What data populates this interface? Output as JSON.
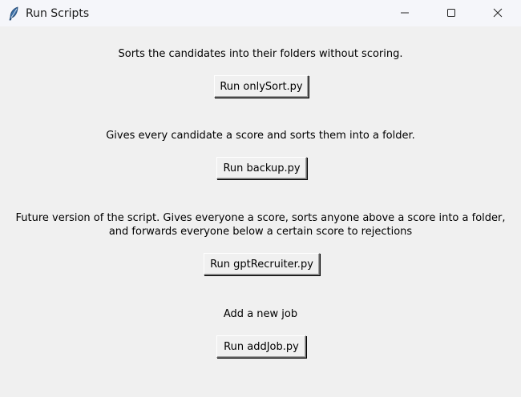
{
  "window": {
    "title": "Run Scripts",
    "controls": [
      "minimize",
      "maximize",
      "close"
    ]
  },
  "sections": [
    {
      "description": "Sorts the candidates into their folders without scoring.",
      "button_label": "Run onlySort.py"
    },
    {
      "description": "Gives every candidate a score and sorts them into a folder.",
      "button_label": "Run backup.py"
    },
    {
      "description": "Future version of the script. Gives everyone a score, sorts anyone above a score into a folder,\nand forwards everyone below a certain score to rejections",
      "button_label": "Run gptRecruiter.py"
    },
    {
      "description": "Add a new job",
      "button_label": "Run addJob.py"
    }
  ],
  "icons": {
    "app": "feather-icon",
    "minimize": "minimize-icon",
    "maximize": "maximize-icon",
    "close": "close-icon"
  },
  "colors": {
    "window_bg": "#f0f0f0",
    "titlebar_bg": "#f5f6fa"
  }
}
